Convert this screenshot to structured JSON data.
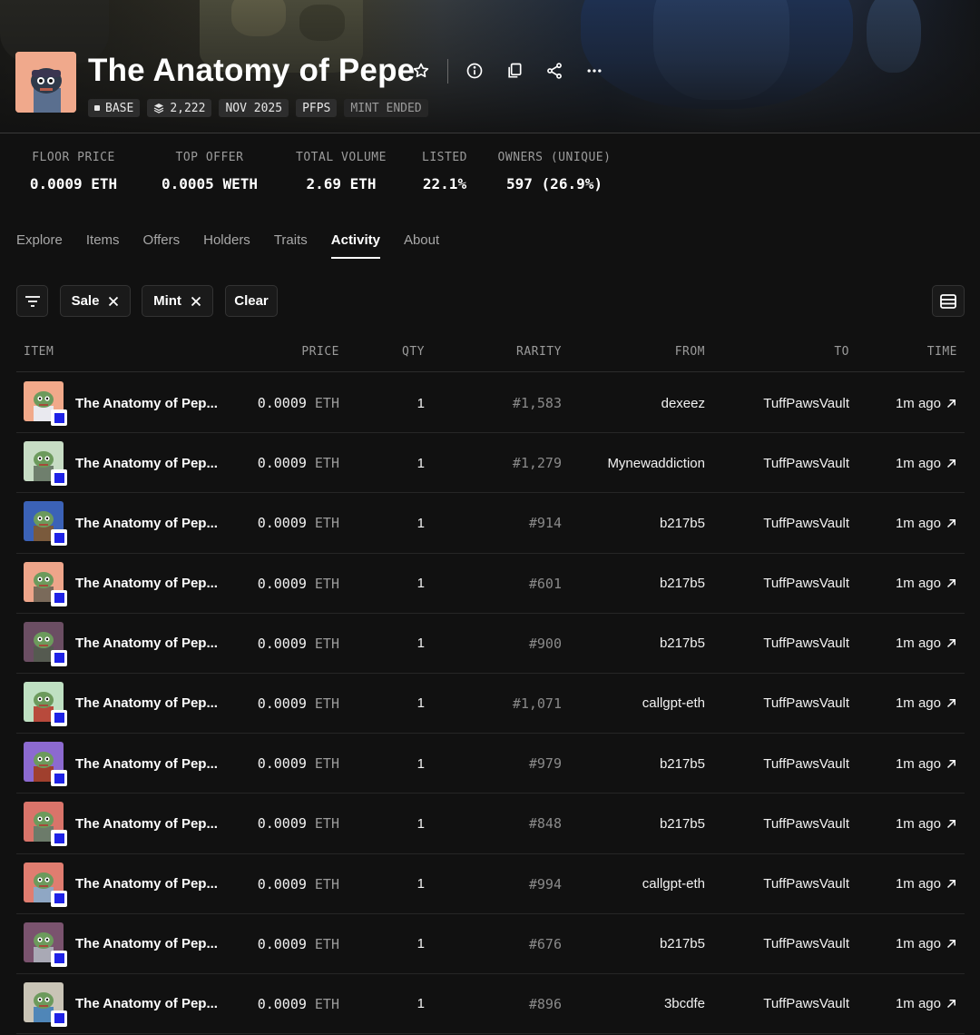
{
  "collection": {
    "title": "The Anatomy of Pepe",
    "pills": [
      {
        "label": "BASE",
        "icon": "base-chain-icon"
      },
      {
        "label": "2,222",
        "icon": "layers-icon"
      },
      {
        "label": "NOV 2025"
      },
      {
        "label": "PFPS"
      },
      {
        "label": "MINT ENDED"
      }
    ]
  },
  "stats": [
    {
      "label": "FLOOR PRICE",
      "value": "0.0009 ETH"
    },
    {
      "label": "TOP OFFER",
      "value": "0.0005 WETH"
    },
    {
      "label": "TOTAL VOLUME",
      "value": "2.69 ETH"
    },
    {
      "label": "LISTED",
      "value": "22.1%"
    },
    {
      "label": "OWNERS (UNIQUE)",
      "value": "597 (26.9%)"
    }
  ],
  "tabs": [
    {
      "label": "Explore"
    },
    {
      "label": "Items"
    },
    {
      "label": "Offers"
    },
    {
      "label": "Holders"
    },
    {
      "label": "Traits"
    },
    {
      "label": "Activity",
      "active": true
    },
    {
      "label": "About"
    }
  ],
  "filters": {
    "chips": [
      "Sale",
      "Mint"
    ],
    "clear_label": "Clear"
  },
  "table": {
    "headers": {
      "item": "ITEM",
      "price": "PRICE",
      "qty": "QTY",
      "rarity": "RARITY",
      "from": "FROM",
      "to": "TO",
      "time": "TIME"
    },
    "rows": [
      {
        "name": "The Anatomy of Pep...",
        "price": "0.0009",
        "unit": "ETH",
        "qty": "1",
        "rarity": "#1,583",
        "from": "dexeez",
        "to": "TuffPawsVault",
        "time": "1m ago",
        "bg": "#f1a98a",
        "body": "#e9e9ef"
      },
      {
        "name": "The Anatomy of Pep...",
        "price": "0.0009",
        "unit": "ETH",
        "qty": "1",
        "rarity": "#1,279",
        "from": "Mynewaddiction",
        "to": "TuffPawsVault",
        "time": "1m ago",
        "bg": "#c7dcc4",
        "body": "#6f7f6d"
      },
      {
        "name": "The Anatomy of Pep...",
        "price": "0.0009",
        "unit": "ETH",
        "qty": "1",
        "rarity": "#914",
        "from": "b217b5",
        "to": "TuffPawsVault",
        "time": "1m ago",
        "bg": "#3b62b7",
        "body": "#7a5a3c"
      },
      {
        "name": "The Anatomy of Pep...",
        "price": "0.0009",
        "unit": "ETH",
        "qty": "1",
        "rarity": "#601",
        "from": "b217b5",
        "to": "TuffPawsVault",
        "time": "1m ago",
        "bg": "#eea58a",
        "body": "#7a6a5a"
      },
      {
        "name": "The Anatomy of Pep...",
        "price": "0.0009",
        "unit": "ETH",
        "qty": "1",
        "rarity": "#900",
        "from": "b217b5",
        "to": "TuffPawsVault",
        "time": "1m ago",
        "bg": "#6b4e63",
        "body": "#555a50"
      },
      {
        "name": "The Anatomy of Pep...",
        "price": "0.0009",
        "unit": "ETH",
        "qty": "1",
        "rarity": "#1,071",
        "from": "callgpt-eth",
        "to": "TuffPawsVault",
        "time": "1m ago",
        "bg": "#bfe0c2",
        "body": "#b84a3c"
      },
      {
        "name": "The Anatomy of Pep...",
        "price": "0.0009",
        "unit": "ETH",
        "qty": "1",
        "rarity": "#979",
        "from": "b217b5",
        "to": "TuffPawsVault",
        "time": "1m ago",
        "bg": "#8c6ad0",
        "body": "#a0402e"
      },
      {
        "name": "The Anatomy of Pep...",
        "price": "0.0009",
        "unit": "ETH",
        "qty": "1",
        "rarity": "#848",
        "from": "b217b5",
        "to": "TuffPawsVault",
        "time": "1m ago",
        "bg": "#d9746a",
        "body": "#6c7b6a"
      },
      {
        "name": "The Anatomy of Pep...",
        "price": "0.0009",
        "unit": "ETH",
        "qty": "1",
        "rarity": "#994",
        "from": "callgpt-eth",
        "to": "TuffPawsVault",
        "time": "1m ago",
        "bg": "#e07d70",
        "body": "#8fa7c4"
      },
      {
        "name": "The Anatomy of Pep...",
        "price": "0.0009",
        "unit": "ETH",
        "qty": "1",
        "rarity": "#676",
        "from": "b217b5",
        "to": "TuffPawsVault",
        "time": "1m ago",
        "bg": "#7a536e",
        "body": "#a9a9b5"
      },
      {
        "name": "The Anatomy of Pep...",
        "price": "0.0009",
        "unit": "ETH",
        "qty": "1",
        "rarity": "#896",
        "from": "3bcdfe",
        "to": "TuffPawsVault",
        "time": "1m ago",
        "bg": "#c9c4b6",
        "body": "#4f86b8"
      }
    ]
  },
  "colors": {
    "background": "#111111",
    "text_muted": "#9b9b9b",
    "chain_badge": "#1f22e6"
  }
}
